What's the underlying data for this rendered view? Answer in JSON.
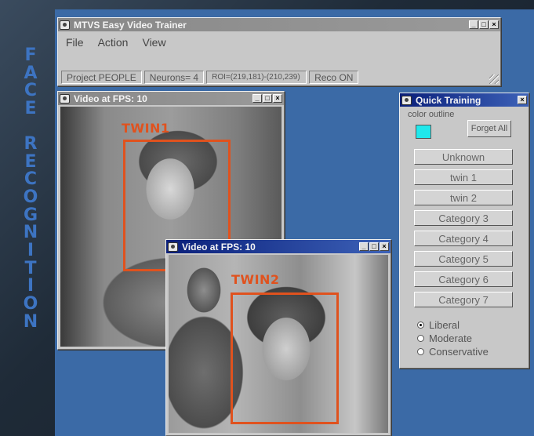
{
  "side_title": [
    "F",
    "A",
    "C",
    "E",
    "",
    "R",
    "E",
    "C",
    "O",
    "G",
    "N",
    "I",
    "T",
    "I",
    "O",
    "N"
  ],
  "trainer": {
    "title": "MTVS Easy Video Trainer",
    "menu": [
      "File",
      "Action",
      "View"
    ],
    "status": [
      "Project PEOPLE",
      "Neurons= 4",
      "ROI=(219,181)-(210,239)",
      "Reco ON"
    ]
  },
  "video1": {
    "title": "Video at FPS: 10",
    "label": "TWIN1"
  },
  "video2": {
    "title": "Video at FPS: 10",
    "label": "TWIN2"
  },
  "quick": {
    "title": "Quick Training",
    "color_outline_label": "color outline",
    "outline_color": "#20e8ec",
    "forget_label": "Forget All",
    "categories": [
      "Unknown",
      "twin 1",
      "twin 2",
      "Category 3",
      "Category 4",
      "Category 5",
      "Category 6",
      "Category 7"
    ],
    "options": [
      {
        "label": "Liberal",
        "selected": true
      },
      {
        "label": "Moderate",
        "selected": false
      },
      {
        "label": "Conservative",
        "selected": false
      }
    ]
  },
  "window_controls": {
    "minimize": "_",
    "maximize": "□",
    "close": "×"
  },
  "colors": {
    "desktop": "#3b6aa6",
    "title_blue": "#3d74c2",
    "box": "#e0521e"
  }
}
